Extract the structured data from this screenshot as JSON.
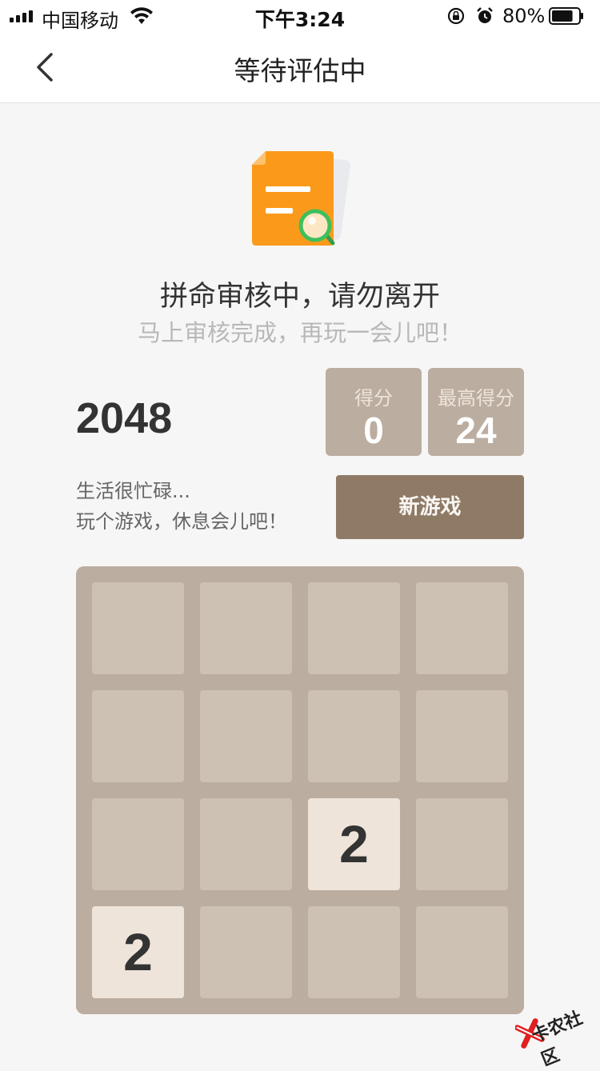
{
  "status_bar": {
    "carrier": "中国移动",
    "time": "下午3:24",
    "battery": "80%",
    "battery_level": 0.8
  },
  "nav": {
    "title": "等待评估中"
  },
  "content": {
    "headline": "拼命审核中，请勿离开",
    "subline": "马上审核完成，再玩一会儿吧！"
  },
  "game": {
    "title": "2048",
    "score_label": "得分",
    "score_value": "0",
    "best_label": "最高得分",
    "best_value": "24",
    "intro_line1": "生活很忙碌...",
    "intro_line2": "玩个游戏，休息会儿吧！",
    "new_game_label": "新游戏",
    "grid": [
      [
        null,
        null,
        null,
        null
      ],
      [
        null,
        null,
        null,
        null
      ],
      [
        null,
        null,
        2,
        null
      ],
      [
        2,
        null,
        null,
        null
      ]
    ]
  },
  "watermark": {
    "text": "卡农社区"
  },
  "colors": {
    "board": "#bbada0",
    "cell": "#cdc1b4",
    "tile_2": "#eee4da",
    "button": "#8f7a66",
    "doc_orange": "#fb9a1a",
    "magnifier_green": "#3fbf5b"
  },
  "icons": {
    "back": "chevron-left-icon",
    "document": "document-search-icon",
    "wifi": "wifi-icon",
    "rotation_lock": "rotation-lock-icon",
    "alarm": "alarm-icon",
    "battery": "battery-icon"
  }
}
